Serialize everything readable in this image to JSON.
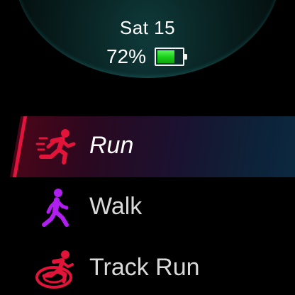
{
  "status": {
    "date": "Sat 15",
    "battery_percent_text": "72%",
    "battery_level": 0.72
  },
  "menu": {
    "items": [
      {
        "label": "Run",
        "icon": "running-icon",
        "color": "#e3143a",
        "selected": true
      },
      {
        "label": "Walk",
        "icon": "walking-icon",
        "color": "#b01ef0",
        "selected": false
      },
      {
        "label": "Track Run",
        "icon": "track-run-icon",
        "color": "#e3143a",
        "selected": false
      }
    ]
  },
  "colors": {
    "selected_accent": "#e0143c",
    "battery_fill": "#1bd11b",
    "dome_glow": "#0f3a3a"
  }
}
